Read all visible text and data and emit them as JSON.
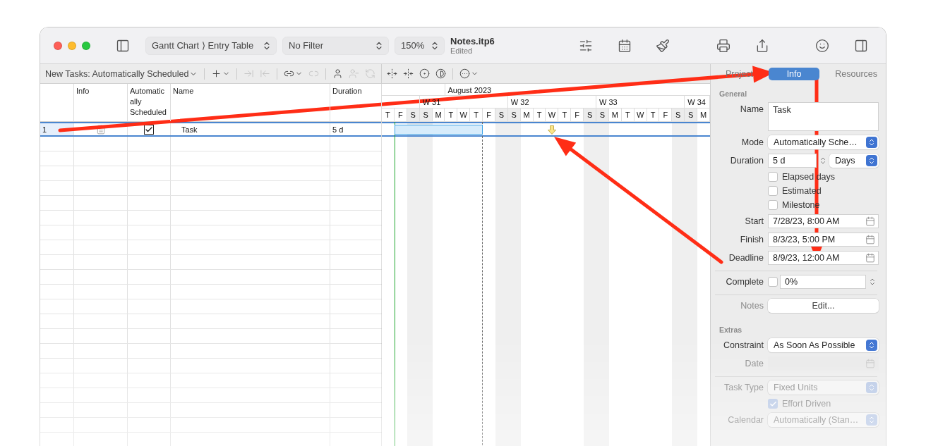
{
  "window": {
    "title": "Notes.itp6",
    "subtitle": "Edited"
  },
  "toolbar": {
    "view_popup": "Gantt Chart ⟩ Entry Table",
    "filter_popup": "No Filter",
    "zoom_popup": "150%"
  },
  "task_toolbar": {
    "new_tasks": "New Tasks: Automatically Scheduled",
    "tool_groups": [
      [
        {
          "kind": "add",
          "disabled": false,
          "menu": true
        }
      ],
      [
        {
          "kind": "indent",
          "disabled": true,
          "menu": false
        },
        {
          "kind": "outdent",
          "disabled": true,
          "menu": false
        }
      ],
      [
        {
          "kind": "link",
          "disabled": false,
          "menu": true
        },
        {
          "kind": "unlink",
          "disabled": true,
          "menu": false
        }
      ],
      [
        {
          "kind": "assign",
          "disabled": false,
          "menu": false
        },
        {
          "kind": "unassign",
          "disabled": true,
          "menu": false
        },
        {
          "kind": "replace",
          "disabled": true,
          "menu": false
        }
      ]
    ]
  },
  "gantt_toolbar": {
    "tool_groups": [
      [
        {
          "kind": "expand",
          "disabled": false,
          "menu": false
        },
        {
          "kind": "collapse",
          "disabled": false,
          "menu": false
        },
        {
          "kind": "center",
          "disabled": false,
          "menu": false
        },
        {
          "kind": "progress",
          "disabled": false,
          "menu": false
        }
      ],
      [
        {
          "kind": "more",
          "disabled": false,
          "menu": true
        }
      ]
    ]
  },
  "table": {
    "columns": [
      "Info",
      "Automatically Scheduled",
      "Name",
      "Duration"
    ],
    "rows": [
      {
        "number": "1",
        "auto_scheduled": true,
        "name": "Task",
        "duration": "5 d",
        "selected": true
      }
    ]
  },
  "gantt": {
    "month": "August 2023",
    "weeks": [
      {
        "days": [
          {
            "letter": "T",
            "weekend": false,
            "bar": false,
            "deadline": false,
            "month_start": false
          },
          {
            "letter": "F",
            "weekend": false,
            "bar": true,
            "deadline": false,
            "month_start": false
          },
          {
            "letter": "S",
            "weekend": true,
            "bar": true,
            "deadline": false,
            "month_start": false
          }
        ]
      },
      {
        "label": "W 31",
        "days": [
          {
            "letter": "S",
            "weekend": true,
            "bar": true,
            "deadline": false,
            "month_start": false
          },
          {
            "letter": "M",
            "weekend": false,
            "bar": true,
            "deadline": false,
            "month_start": false
          },
          {
            "letter": "T",
            "weekend": false,
            "bar": true,
            "deadline": false,
            "month_start": true
          },
          {
            "letter": "W",
            "weekend": false,
            "bar": true,
            "deadline": false,
            "month_start": false
          },
          {
            "letter": "T",
            "weekend": false,
            "bar": true,
            "deadline": false,
            "month_start": false
          },
          {
            "letter": "F",
            "weekend": false,
            "bar": false,
            "deadline": false,
            "month_start": false
          },
          {
            "letter": "S",
            "weekend": true,
            "bar": false,
            "deadline": false,
            "month_start": false
          }
        ]
      },
      {
        "label": "W 32",
        "days": [
          {
            "letter": "S",
            "weekend": true,
            "bar": false,
            "deadline": false,
            "month_start": false
          },
          {
            "letter": "M",
            "weekend": false,
            "bar": false,
            "deadline": false,
            "month_start": false
          },
          {
            "letter": "T",
            "weekend": false,
            "bar": false,
            "deadline": false,
            "month_start": false
          },
          {
            "letter": "W",
            "weekend": false,
            "bar": false,
            "deadline": true,
            "month_start": false
          },
          {
            "letter": "T",
            "weekend": false,
            "bar": false,
            "deadline": false,
            "month_start": false
          },
          {
            "letter": "F",
            "weekend": false,
            "bar": false,
            "deadline": false,
            "month_start": false
          },
          {
            "letter": "S",
            "weekend": true,
            "bar": false,
            "deadline": false,
            "month_start": false
          }
        ]
      },
      {
        "label": "W 33",
        "days": [
          {
            "letter": "S",
            "weekend": true,
            "bar": false,
            "deadline": false,
            "month_start": false
          },
          {
            "letter": "M",
            "weekend": false,
            "bar": false,
            "deadline": false,
            "month_start": false
          },
          {
            "letter": "T",
            "weekend": false,
            "bar": false,
            "deadline": false,
            "month_start": false
          },
          {
            "letter": "W",
            "weekend": false,
            "bar": false,
            "deadline": false,
            "month_start": false
          },
          {
            "letter": "T",
            "weekend": false,
            "bar": false,
            "deadline": false,
            "month_start": false
          },
          {
            "letter": "F",
            "weekend": false,
            "bar": false,
            "deadline": false,
            "month_start": false
          },
          {
            "letter": "S",
            "weekend": true,
            "bar": false,
            "deadline": false,
            "month_start": false
          }
        ]
      },
      {
        "label": "W 34",
        "days": [
          {
            "letter": "S",
            "weekend": true,
            "bar": false,
            "deadline": false,
            "month_start": false
          },
          {
            "letter": "M",
            "weekend": false,
            "bar": false,
            "deadline": false,
            "month_start": false
          }
        ]
      }
    ]
  },
  "inspector": {
    "tabs": [
      {
        "label": "Project",
        "selected": false
      },
      {
        "label": "Info",
        "selected": true
      },
      {
        "label": "Resources",
        "selected": false
      }
    ],
    "general": {
      "heading": "General",
      "name_label": "Name",
      "name_value": "Task",
      "mode_label": "Mode",
      "mode_value": "Automatically Sche…",
      "duration_label": "Duration",
      "duration_value": "5 d",
      "duration_unit": "Days",
      "options": [
        {
          "label": "Elapsed days",
          "checked": false
        },
        {
          "label": "Estimated",
          "checked": false
        },
        {
          "label": "Milestone",
          "checked": false
        }
      ],
      "dates": [
        {
          "label": "Start",
          "value": "7/28/23, 8:00 AM"
        },
        {
          "label": "Finish",
          "value": "8/3/23, 5:00 PM"
        },
        {
          "label": "Deadline",
          "value": "8/9/23, 12:00 AM"
        }
      ],
      "complete_label": "Complete",
      "complete_checked": false,
      "complete_value": "0%",
      "notes_label": "Notes",
      "notes_button": "Edit..."
    },
    "extras": {
      "heading": "Extras",
      "rows": [
        {
          "kind": "select",
          "label": "Constraint",
          "value": "As Soon As Possible",
          "disabled": false
        },
        {
          "kind": "date",
          "label": "Date",
          "disabled": true
        },
        {
          "kind": "select",
          "label": "Task Type",
          "value": "Fixed Units",
          "disabled": true
        },
        {
          "kind": "checkbox",
          "label": "Effort Driven",
          "checked": true,
          "disabled": true
        },
        {
          "kind": "select",
          "label": "Calendar",
          "value": "Automatically (Stan…",
          "disabled": true
        }
      ]
    }
  }
}
